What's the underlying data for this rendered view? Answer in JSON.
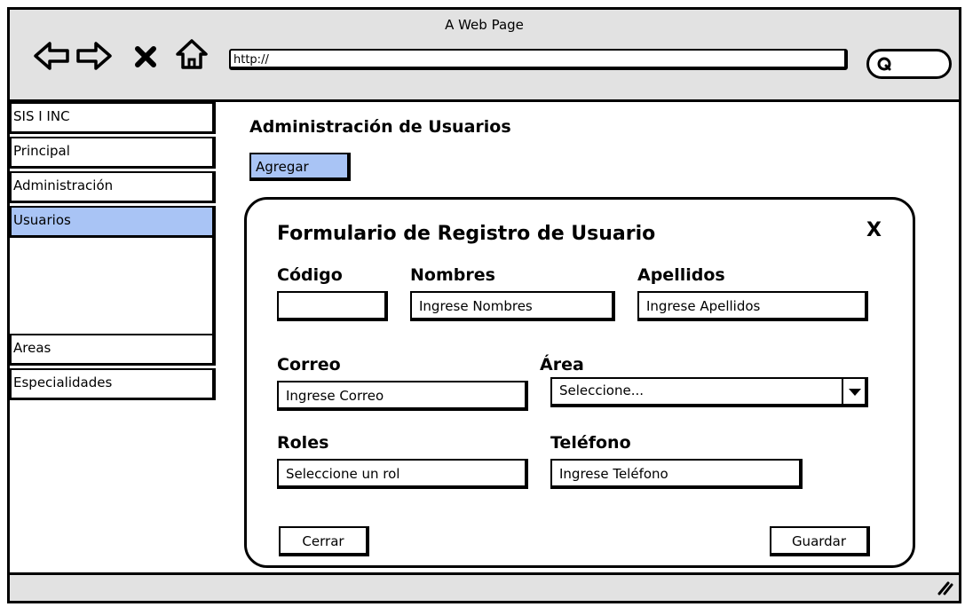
{
  "window": {
    "title": "A Web Page"
  },
  "browser": {
    "url": "http://"
  },
  "icons": {
    "back": "arrow-left-icon",
    "forward": "arrow-right-icon",
    "stop": "close-x-icon",
    "home": "home-icon",
    "search": "search-icon",
    "resize": "resize-grip-icon"
  },
  "sidebar": {
    "items": [
      {
        "label": "SIS I INC"
      },
      {
        "label": "Principal"
      },
      {
        "label": "Administración"
      },
      {
        "label": "Usuarios",
        "selected": true
      },
      {
        "label": "Areas"
      },
      {
        "label": "Especialidades"
      }
    ]
  },
  "main": {
    "title": "Administración de Usuarios",
    "add_button": "Agregar"
  },
  "modal": {
    "title": "Formulario de Registro de Usuario",
    "close": "X",
    "fields": {
      "codigo": {
        "label": "Código",
        "value": ""
      },
      "nombres": {
        "label": "Nombres",
        "value": "Ingrese Nombres"
      },
      "apellidos": {
        "label": "Apellidos",
        "value": "Ingrese Apellidos"
      },
      "correo": {
        "label": "Correo",
        "value": "Ingrese Correo"
      },
      "area": {
        "label": "Área",
        "value": "Seleccione..."
      },
      "roles": {
        "label": "Roles",
        "value": "Seleccione un rol"
      },
      "telefono": {
        "label": "Teléfono",
        "value": "Ingrese Teléfono"
      }
    },
    "buttons": {
      "close": "Cerrar",
      "save": "Guardar"
    }
  },
  "colors": {
    "selected": "#a9c4f5",
    "chrome": "#e2e2e2",
    "border": "#000000"
  }
}
